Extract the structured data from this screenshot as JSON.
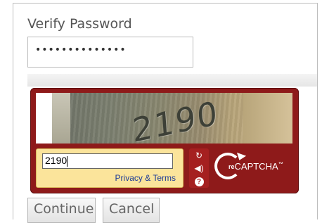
{
  "form": {
    "verify_label": "Verify Password",
    "password_masked": "••••••••••••••"
  },
  "captcha": {
    "image_text": "2190",
    "answer_value": "2190",
    "privacy_link": "Privacy & Terms",
    "brand_prefix": "re",
    "brand_name": "CAPTCHA",
    "trademark": "™",
    "colors": {
      "frame": "#8e1a1a",
      "answer_bg": "#fbe49b",
      "link": "#1c3a97"
    }
  },
  "buttons": {
    "continue": "Continue",
    "cancel": "Cancel"
  }
}
